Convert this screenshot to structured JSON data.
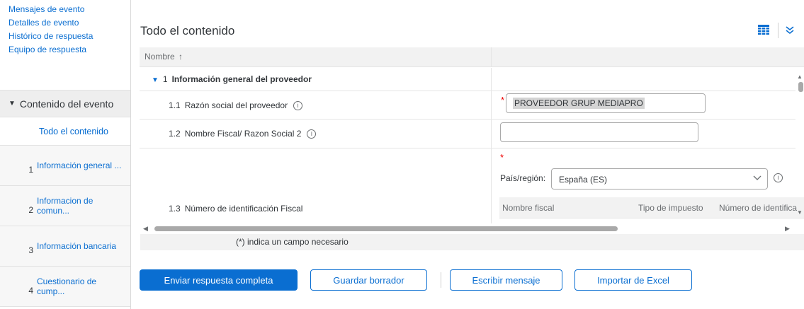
{
  "sidebar": {
    "links": [
      "Mensajes de evento",
      "Detalles de evento",
      "Histórico de respuesta",
      "Equipo de respuesta"
    ],
    "section_label": "Contenido del evento",
    "all_content": "Todo el contenido",
    "items": [
      {
        "num": "1",
        "label": "Información general ..."
      },
      {
        "num": "2",
        "label": "Informacion de comun..."
      },
      {
        "num": "3",
        "label": "Información bancaria"
      },
      {
        "num": "4",
        "label": "Cuestionario de cump..."
      }
    ]
  },
  "main": {
    "title": "Todo el contenido",
    "column_name": "Nombre",
    "sort_icon": "↑",
    "section": {
      "num": "1",
      "label": "Información general del proveedor"
    },
    "rows": [
      {
        "num": "1.1",
        "label": "Razón social del proveedor",
        "value": "PROVEEDOR GRUP MEDIAPRO"
      },
      {
        "num": "1.2",
        "label": "Nombre Fiscal/ Razon Social 2",
        "value": ""
      },
      {
        "num": "1.3",
        "label": "Número de identificación Fiscal"
      }
    ],
    "country_label": "País/región:",
    "country_value": "España (ES)",
    "subtable_headers": [
      "Nombre fiscal",
      "Tipo de impuesto",
      "Número de identifica"
    ],
    "footnote": "(*) indica un campo necesario"
  },
  "buttons": {
    "submit": "Enviar respuesta completa",
    "save_draft": "Guardar borrador",
    "message": "Escribir mensaje",
    "import_excel": "Importar de Excel"
  },
  "colors": {
    "accent": "#0a6ed1",
    "required": "#ee0000"
  }
}
